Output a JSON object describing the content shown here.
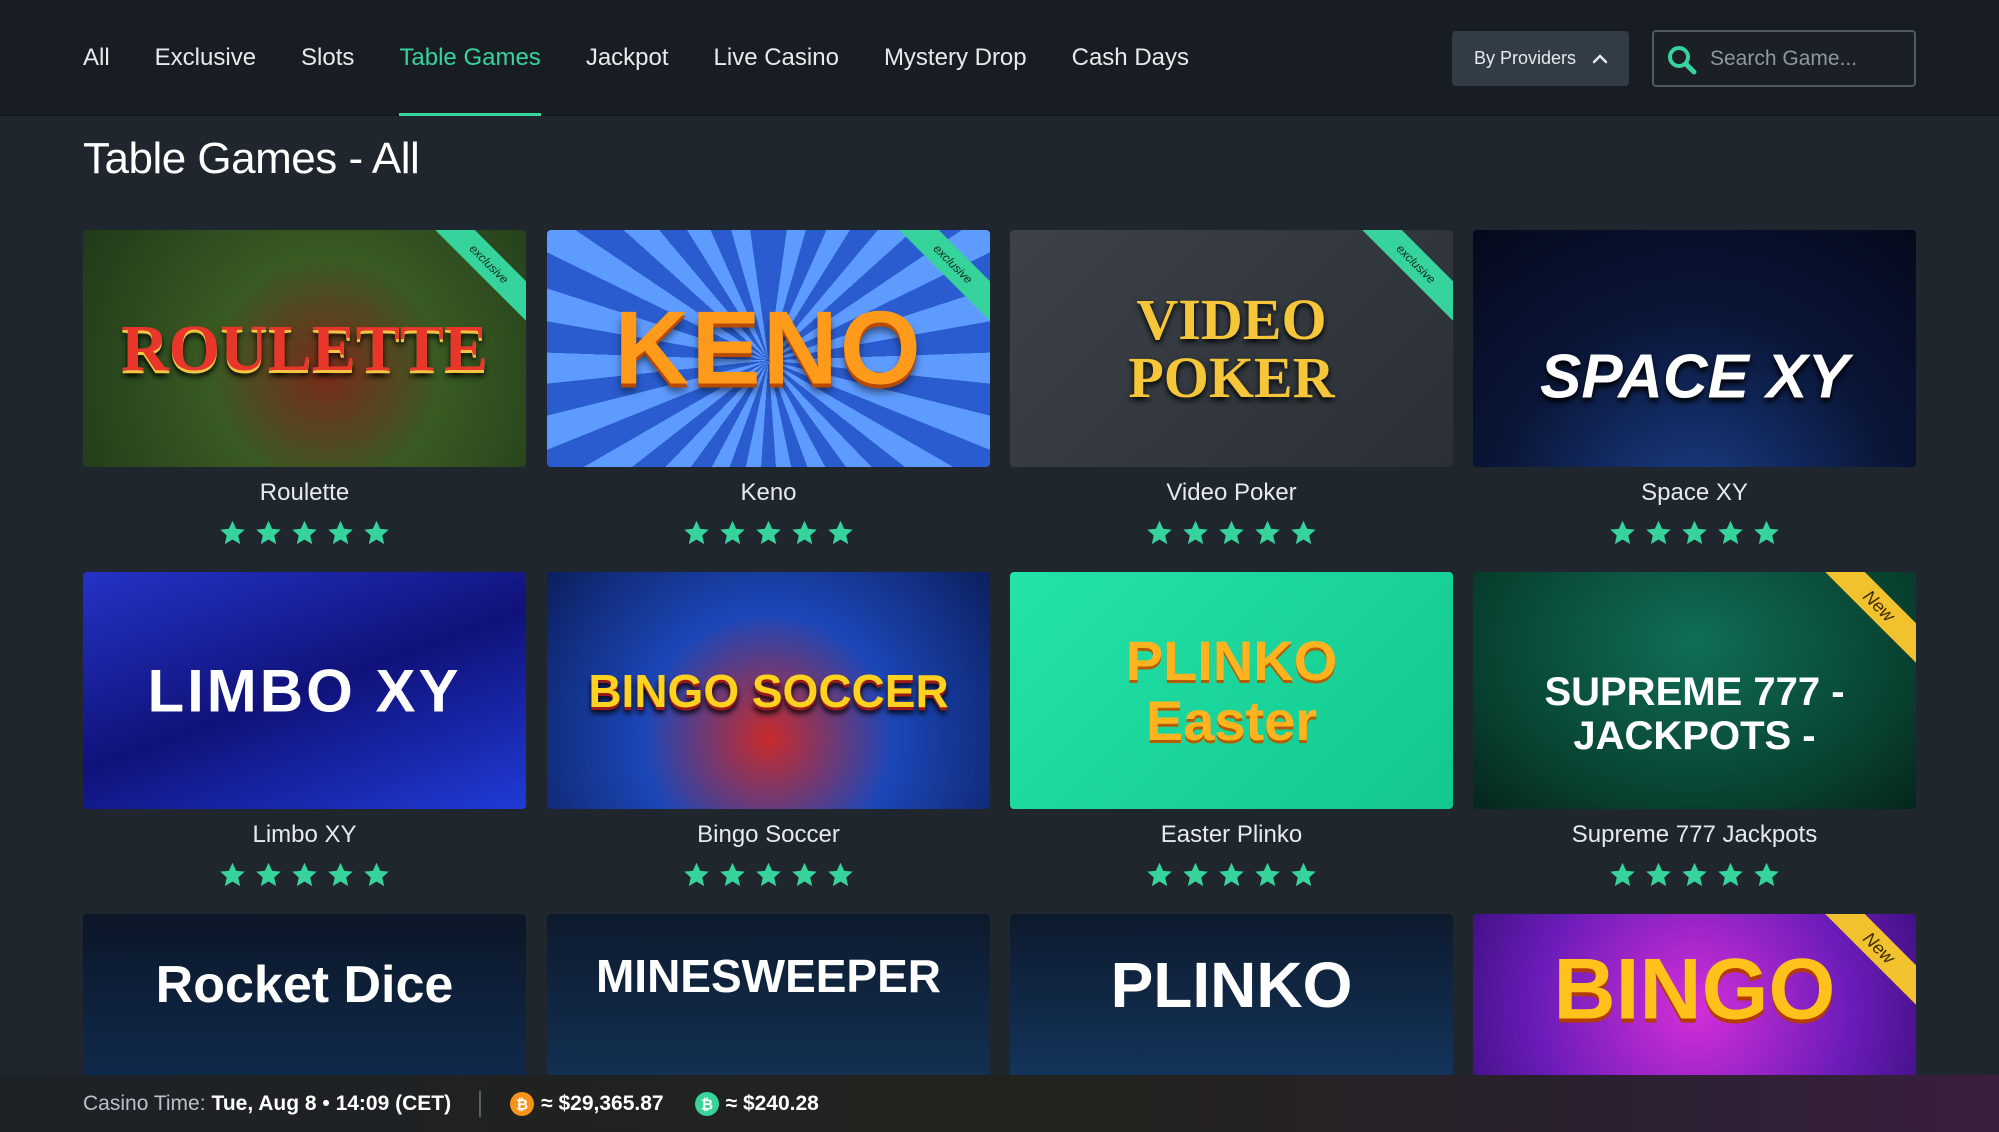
{
  "nav": {
    "items": [
      {
        "label": "All"
      },
      {
        "label": "Exclusive"
      },
      {
        "label": "Slots"
      },
      {
        "label": "Table Games"
      },
      {
        "label": "Jackpot"
      },
      {
        "label": "Live Casino"
      },
      {
        "label": "Mystery Drop"
      },
      {
        "label": "Cash Days"
      }
    ],
    "active_index": 3,
    "providers_label": "By Providers",
    "search_placeholder": "Search Game..."
  },
  "page": {
    "title": "Table Games - All"
  },
  "games": [
    {
      "name": "Roulette",
      "thumb_text": "ROULETTE",
      "badge": "exclusive",
      "rating": 5
    },
    {
      "name": "Keno",
      "thumb_text": "KENO",
      "badge": "exclusive",
      "rating": 5
    },
    {
      "name": "Video Poker",
      "thumb_text": "VIDEO POKER",
      "badge": "exclusive",
      "rating": 5
    },
    {
      "name": "Space XY",
      "thumb_text": "SPACE XY",
      "badge": "",
      "rating": 5
    },
    {
      "name": "Limbo XY",
      "thumb_text": "LIMBO XY",
      "badge": "",
      "rating": 5
    },
    {
      "name": "Bingo Soccer",
      "thumb_text": "BINGO SOCCER",
      "badge": "",
      "rating": 5
    },
    {
      "name": "Easter Plinko",
      "thumb_text": "PLINKO Easter",
      "badge": "",
      "rating": 5
    },
    {
      "name": "Supreme 777 Jackpots",
      "thumb_text": "SUPREME 777 - JACKPOTS -",
      "badge": "New",
      "rating": 5
    },
    {
      "name": "",
      "thumb_text": "Rocket Dice",
      "badge": "",
      "rating": null
    },
    {
      "name": "",
      "thumb_text": "MINESWEEPER",
      "badge": "",
      "rating": null
    },
    {
      "name": "",
      "thumb_text": "PLINKO",
      "badge": "",
      "rating": null
    },
    {
      "name": "",
      "thumb_text": "BINGO",
      "badge": "New",
      "rating": null
    }
  ],
  "footer": {
    "casino_time_label": "Casino Time:",
    "casino_time_value": "Tue, Aug 8 • 14:09 (CET)",
    "btc_value": "≈ $29,365.87",
    "bch_value": "≈ $240.28"
  },
  "colors": {
    "accent": "#37d39d",
    "background": "#1f262d",
    "topbar": "#171d23"
  }
}
